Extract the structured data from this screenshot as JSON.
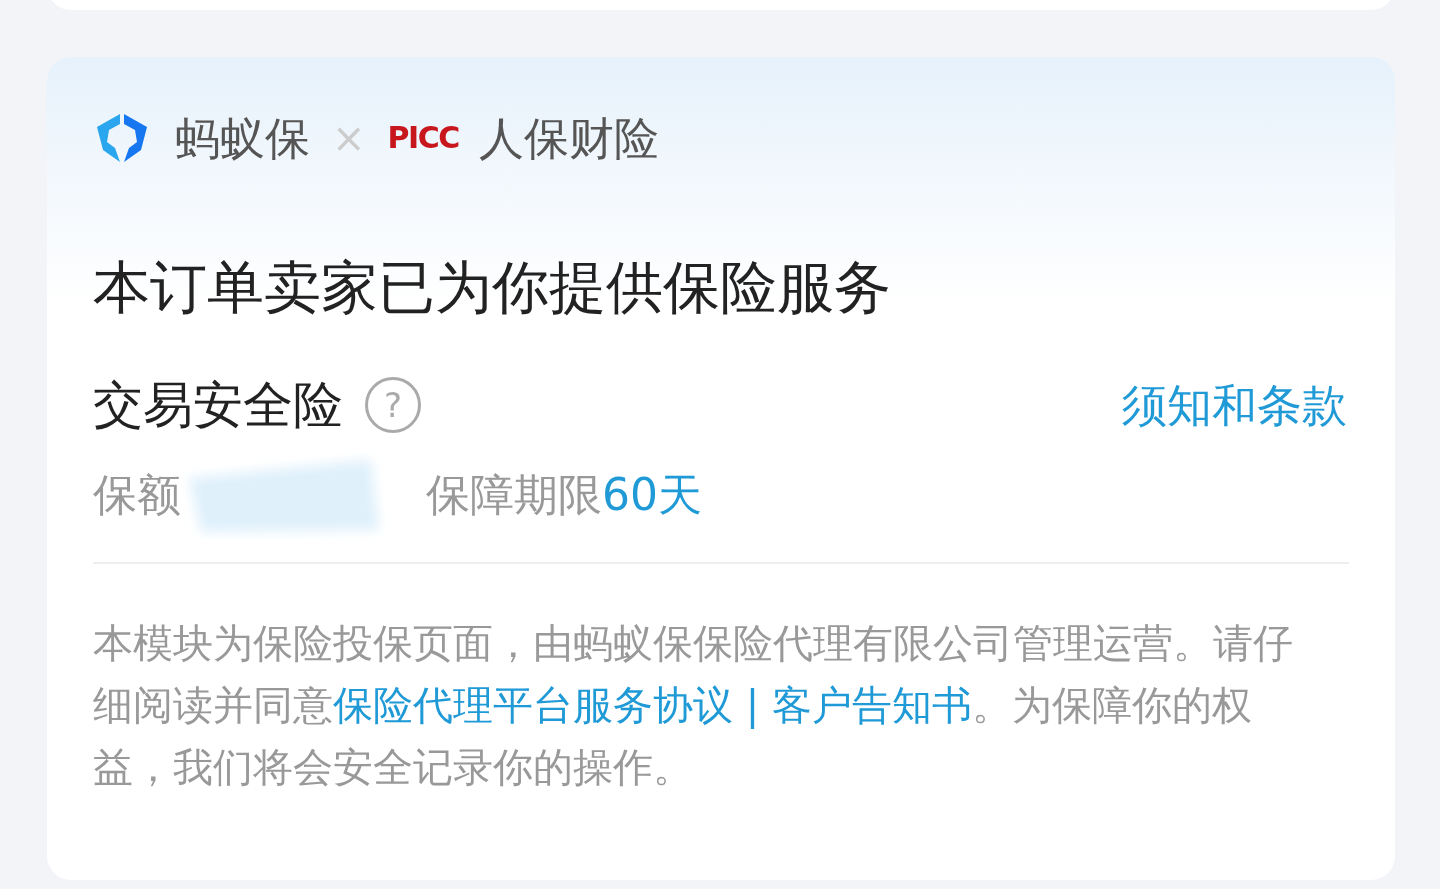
{
  "brand": {
    "partner_a": "蚂蚁保",
    "separator": "×",
    "partner_b_logo": "PICC",
    "partner_b": "人保财险"
  },
  "headline": "本订单卖家已为你提供保险服务",
  "product": {
    "name": "交易安全险",
    "help_icon": "?",
    "terms_link": "须知和条款"
  },
  "coverage": {
    "amount_label": "保额",
    "period_label": "保障期限",
    "period_value": "60天"
  },
  "notice": {
    "before": "本模块为保险投保页面，由蚂蚁保保险代理有限公司管理运营。请仔细阅读并同意",
    "links": [
      "保险代理平台服务协议",
      "客户告知书"
    ],
    "link_separator": " | ",
    "after": "。为保障你的权益，我们将会安全记录你的操作。"
  }
}
